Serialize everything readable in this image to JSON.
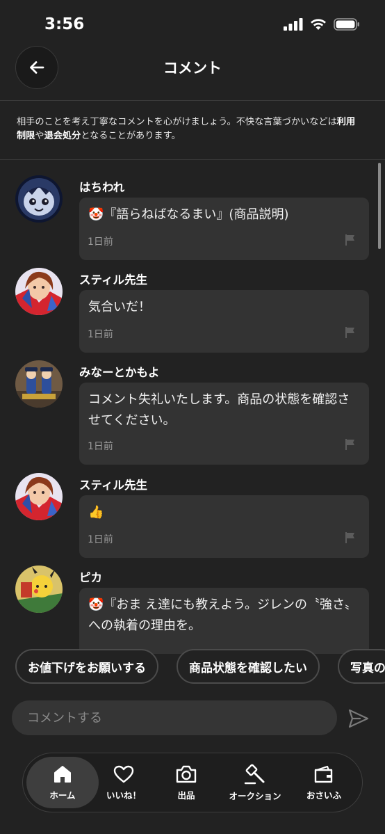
{
  "status": {
    "time": "3:56"
  },
  "header": {
    "title": "コメント"
  },
  "notice": {
    "text_a": "相手のことを考え丁寧なコメントを心がけましょう。不快な言葉づかいなどは",
    "bold_a": "利用制限",
    "text_b": "や",
    "bold_b": "退会処分",
    "text_c": "となることがあります。"
  },
  "comments": [
    {
      "user": "はちわれ",
      "emoji": "🤡",
      "text": "『語らねばなるまい』(商品説明)",
      "time": "1日前"
    },
    {
      "user": "スティル先生",
      "emoji": "",
      "text": "気合いだ！",
      "time": "1日前"
    },
    {
      "user": "みなーとかもよ",
      "emoji": "",
      "text": "コメント失礼いたします。商品の状態を確認させてください。",
      "time": "1日前"
    },
    {
      "user": "スティル先生",
      "emoji": "👍",
      "text": "",
      "time": "1日前"
    },
    {
      "user": "ピカ",
      "emoji": "🤡",
      "text": "『おま え達にも教えよう。ジレンの〝強さ〟への執着の理由を。",
      "time": ""
    }
  ],
  "quick_replies": [
    "お値下げをお願いする",
    "商品状態を確認したい",
    "写真の"
  ],
  "input": {
    "placeholder": "コメントする"
  },
  "tabs": [
    {
      "label": "ホーム",
      "icon": "home-icon",
      "active": true
    },
    {
      "label": "いいね！",
      "icon": "heart-icon",
      "active": false
    },
    {
      "label": "出品",
      "icon": "camera-icon",
      "active": false
    },
    {
      "label": "オークション",
      "icon": "gavel-icon",
      "active": false
    },
    {
      "label": "おさいふ",
      "icon": "wallet-icon",
      "active": false
    }
  ]
}
